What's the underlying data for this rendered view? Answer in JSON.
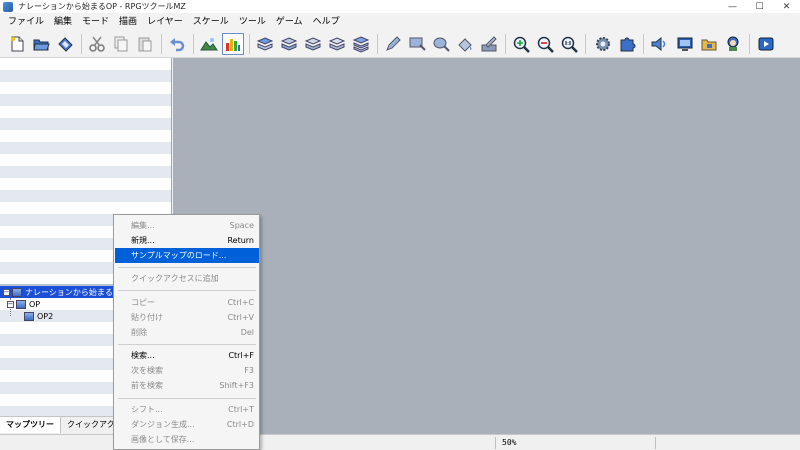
{
  "window": {
    "title": "ナレーションから始まるOP - RPGツクールMZ",
    "minimize": "—",
    "maximize": "☐",
    "close": "✕"
  },
  "menu": [
    "ファイル",
    "編集",
    "モード",
    "描画",
    "レイヤー",
    "スケール",
    "ツール",
    "ゲーム",
    "ヘルプ"
  ],
  "toolbar": {
    "buttons": [
      "new-project",
      "open-project",
      "save-project",
      "cut",
      "copy",
      "paste",
      "undo",
      "map-mode",
      "event-mode",
      "layer-1",
      "layer-2",
      "layer-3",
      "layer-4",
      "layer-auto",
      "pencil",
      "rectangle",
      "ellipse",
      "flood-fill",
      "shadow-pen",
      "zoom-in",
      "zoom-out",
      "zoom-actual",
      "database",
      "plugin-manager",
      "sound-test",
      "event-searcher",
      "resource-manager",
      "character-generator",
      "playtest"
    ],
    "active": "event-mode"
  },
  "tree": {
    "root": "ナレーションから始まるOP",
    "children": [
      "OP",
      "OP2"
    ]
  },
  "tabs": [
    "マップツリー",
    "クイックアクセス"
  ],
  "status": {
    "zoom": "50%"
  },
  "context_menu": [
    {
      "label": "編集...",
      "shortcut": "Space",
      "state": "disabled"
    },
    {
      "label": "新規...",
      "shortcut": "Return",
      "state": "enabled"
    },
    {
      "label": "サンプルマップのロード...",
      "shortcut": "",
      "state": "highlighted"
    },
    {
      "label": "クイックアクセスに追加",
      "shortcut": "",
      "state": "disabled"
    },
    {
      "label": "コピー",
      "shortcut": "Ctrl+C",
      "state": "disabled"
    },
    {
      "label": "貼り付け",
      "shortcut": "Ctrl+V",
      "state": "disabled"
    },
    {
      "label": "削除",
      "shortcut": "Del",
      "state": "disabled"
    },
    {
      "label": "検索...",
      "shortcut": "Ctrl+F",
      "state": "enabled"
    },
    {
      "label": "次を検索",
      "shortcut": "F3",
      "state": "disabled"
    },
    {
      "label": "前を検索",
      "shortcut": "Shift+F3",
      "state": "disabled"
    },
    {
      "label": "シフト...",
      "shortcut": "Ctrl+T",
      "state": "disabled"
    },
    {
      "label": "ダンジョン生成...",
      "shortcut": "Ctrl+D",
      "state": "disabled"
    },
    {
      "label": "画像として保存...",
      "shortcut": "",
      "state": "disabled"
    }
  ]
}
